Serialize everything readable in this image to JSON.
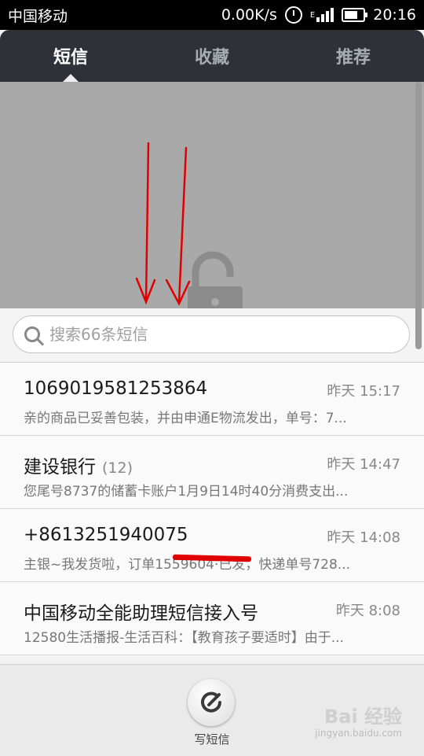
{
  "status_bar": {
    "carrier": "中国移动",
    "network_speed": "0.00K/s",
    "network_type": "E",
    "time": "20:16"
  },
  "tabs": [
    {
      "label": "短信",
      "active": true
    },
    {
      "label": "收藏",
      "active": false
    },
    {
      "label": "推荐",
      "active": false
    }
  ],
  "search": {
    "placeholder": "搜索66条短信"
  },
  "messages": [
    {
      "sender": "1069019581253864",
      "count": "",
      "time": "昨天 15:17",
      "snippet": "亲的商品已妥善包装，并由申通E物流发出，单号：7..."
    },
    {
      "sender": "建设银行",
      "count": "(12)",
      "time": "昨天 14:47",
      "snippet": "您尾号8737的储蓄卡账户1月9日14时40分消费支出..."
    },
    {
      "sender": "+8613251940075",
      "count": "",
      "time": "昨天 14:08",
      "snippet": "主银~我发货啦，订单1559604·已发，快递单号728..."
    },
    {
      "sender": "中国移动全能助理短信接入号",
      "count": "",
      "time": "昨天 8:08",
      "snippet": "12580生活播报-生活百科：【教育孩子要适时】由于..."
    }
  ],
  "bottom": {
    "compose_label": "写短信",
    "watermark": "Bai 经验",
    "watermark_url": "jingyan.baidu.com"
  },
  "colors": {
    "tab_bar": "#2e3238",
    "pulldown": "#a9a9a9",
    "annotation_arrow": "#e00000"
  }
}
